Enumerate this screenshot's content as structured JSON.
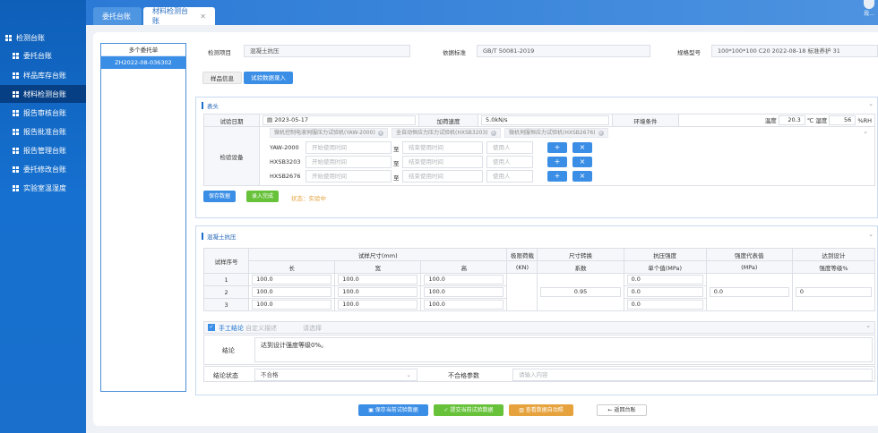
{
  "sidebar": {
    "header": "检测台账",
    "items": [
      {
        "label": "委托台账"
      },
      {
        "label": "样品库存台账"
      },
      {
        "label": "材料检测台账",
        "active": true
      },
      {
        "label": "报告审核台账"
      },
      {
        "label": "报告批准台账"
      },
      {
        "label": "报告管理台账"
      },
      {
        "label": "委托修改台账"
      },
      {
        "label": "实验室温湿度"
      }
    ]
  },
  "tabs": [
    {
      "label": "委托台账"
    },
    {
      "label": "材料检测台账"
    }
  ],
  "user": {
    "name": "段..."
  },
  "left_list": {
    "header": "多个委托单",
    "items": [
      "ZH2022-08-036302"
    ]
  },
  "info": {
    "item_label": "检测项目",
    "item_value": "混凝土抗压",
    "basis_label": "依据标准",
    "basis_value": "GB/T 50081-2019",
    "spec_label": "规格型号",
    "spec_value": "100*100*100 C20  2022-08-18 标准养护 31"
  },
  "subtabs": [
    "样品信息",
    "试验数据录入"
  ],
  "header_section": {
    "title": "表头",
    "test_date_label": "试验日期",
    "test_date": "2023-05-17",
    "load_speed_label": "加荷速度",
    "load_speed": "5.0kN/s",
    "env_label": "环境条件",
    "temp_label": "温度",
    "temp_value": "20.3",
    "temp_unit": "℃ 湿度",
    "humidity_value": "56",
    "humidity_unit": "%RH",
    "equipment_label": "检验设备",
    "chips": [
      "微机控制电液伺服压力试验机(YAW-2000)",
      "全自动恒应力压力试验机(HXSB3203)",
      "微机伺服恒应力试验机(HXSB2676)"
    ],
    "equip_rows": [
      {
        "name": "YAW-2000",
        "start_ph": "开始使用时间",
        "to": "至",
        "end_ph": "结束使用时间",
        "user_ph": "使用人"
      },
      {
        "name": "HXSB3203",
        "start_ph": "开始使用时间",
        "to": "至",
        "end_ph": "结束使用时间",
        "user_ph": "使用人"
      },
      {
        "name": "HXSB2676",
        "start_ph": "开始使用时间",
        "to": "至",
        "end_ph": "结束使用时间",
        "user_ph": "使用人"
      }
    ],
    "plus": "+",
    "times": "×",
    "save_btn": "保存数据",
    "done_btn": "录入完成",
    "status": "状态：实验中"
  },
  "concrete_section": {
    "title": "混凝土抗压",
    "headers": {
      "seq": "试样序号",
      "size": "试样尺寸(mm)",
      "length": "长",
      "width": "宽",
      "height": "高",
      "load": "极限荷载",
      "load_unit": "(KN)",
      "conv": "尺寸转换",
      "conv_sub": "系数",
      "strength": "抗压强度",
      "strength_sub": "单个值(MPa)",
      "rep": "强度代表值",
      "rep_sub": "(MPa)",
      "design": "达到设计",
      "design_sub": "强度等级%"
    },
    "rows": [
      {
        "seq": "1",
        "l": "100.0",
        "w": "100.0",
        "h": "100.0",
        "strength": "0.0"
      },
      {
        "seq": "2",
        "l": "100.0",
        "w": "100.0",
        "h": "100.0",
        "strength": "0.0"
      },
      {
        "seq": "3",
        "l": "100.0",
        "w": "100.0",
        "h": "100.0",
        "strength": "0.0"
      }
    ],
    "conv_value": "0.95",
    "rep_value": "0.0",
    "design_value": "0",
    "manual_label": "手工结论",
    "custom_ph": "自定义描述",
    "select_ph": "请选择",
    "conclusion_label": "结论",
    "conclusion_value": "达到设计强度等级0%。",
    "status_label": "结论状态",
    "status_value": "不合格",
    "unqualified_label": "不合格参数",
    "unqualified_ph": "请输入内容"
  },
  "footer": {
    "save": "保存当前试验数据",
    "submit": "提交当前试验数据",
    "view": "查看数据自动照",
    "back": "返回台账"
  }
}
